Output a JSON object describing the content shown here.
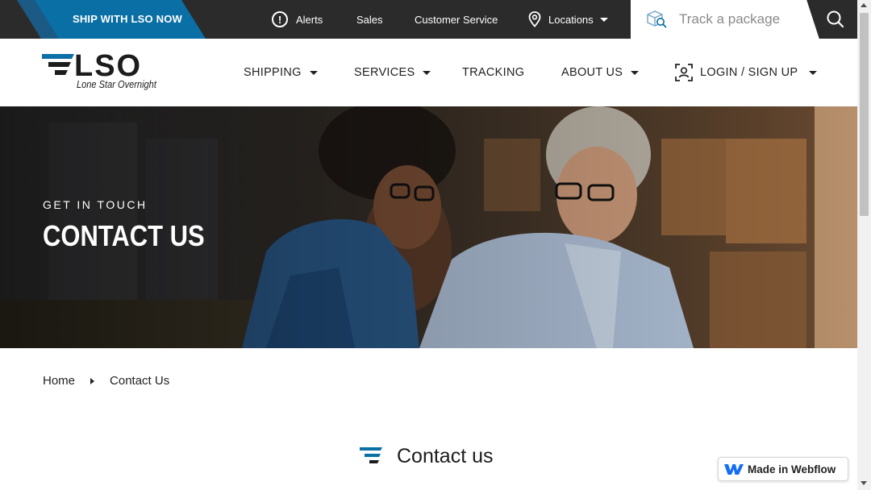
{
  "topbar": {
    "ship_label": "SHIP WITH LSO NOW",
    "alerts_label": "Alerts",
    "sales_label": "Sales",
    "customer_service_label": "Customer Service",
    "locations_label": "Locations",
    "track_placeholder": "Track a package"
  },
  "logo": {
    "text": "LSO",
    "tagline": "Lone Star Overnight"
  },
  "nav": {
    "shipping": "SHIPPING",
    "services": "SERVICES",
    "tracking": "TRACKING",
    "about": "ABOUT US",
    "login": "LOGIN / SIGN UP"
  },
  "hero": {
    "kicker": "GET IN TOUCH",
    "title": "CONTACT US"
  },
  "breadcrumb": {
    "home": "Home",
    "current": "Contact Us"
  },
  "section": {
    "title": "Contact us"
  },
  "badge": {
    "label": "Made in Webflow"
  },
  "colors": {
    "topbar": "#2b2b2b",
    "brand_blue": "#0a6fa5",
    "text": "#222222"
  },
  "icons": [
    "alert-icon",
    "location-pin-icon",
    "package-search-icon",
    "search-icon",
    "user-scan-icon",
    "webflow-logo-icon",
    "logo-speed-lines-icon",
    "section-lines-icon"
  ]
}
